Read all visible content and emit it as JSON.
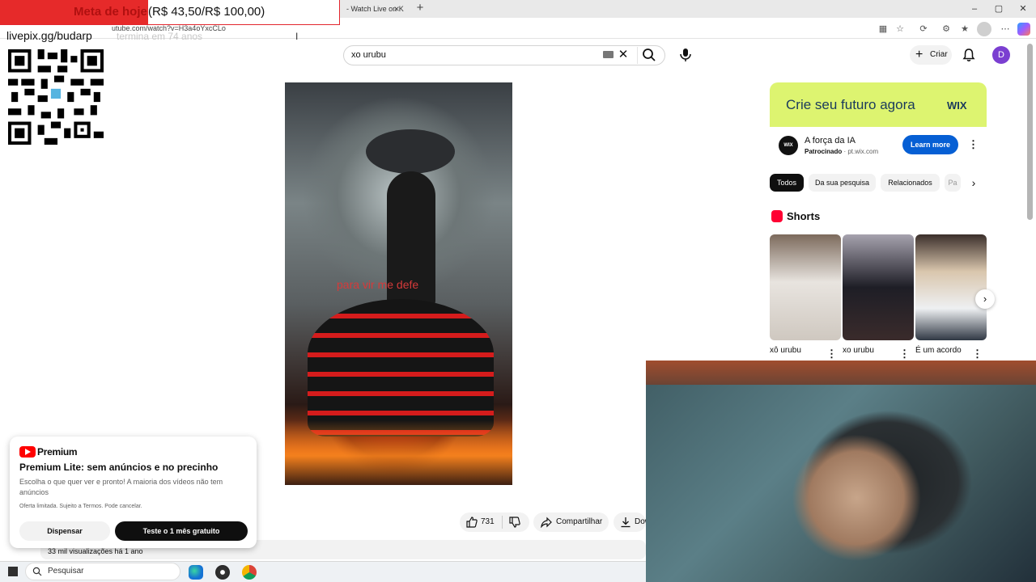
{
  "browser": {
    "tab_fragment": "- Watch Live on K",
    "tab_close": "×",
    "new_tab": "+",
    "url": "utube.com/watch?v=H3a4oYxcCLo",
    "window_controls": [
      "–",
      "▢",
      "✕"
    ]
  },
  "overlay": {
    "goal_label": "Meta de hoje",
    "goal_amount": "(R$ 43,50/R$ 100,00)",
    "goal_progress": 0.435,
    "livepix_user": "livepix.gg/budarp",
    "ghost_text": "termina em 74 anos"
  },
  "youtube": {
    "search_value": "xo urubu",
    "create_label": "Criar",
    "avatar_letter": "D"
  },
  "video": {
    "caption": "para vir me defe"
  },
  "actions": {
    "like_count": "731",
    "share_label": "Compartilhar",
    "download_label": "Download"
  },
  "description": {
    "views": "33 mil visualizações  há 1 ano"
  },
  "premium": {
    "brand": "Premium",
    "title": "Premium Lite: sem anúncios e no precinho",
    "description": "Escolha o que quer ver e pronto! A maioria dos vídeos não tem anúncios",
    "fine_print": "Oferta limitada. Sujeito a Termos. Pode cancelar.",
    "dismiss_label": "Dispensar",
    "trial_label": "Teste o 1 mês gratuito"
  },
  "ad": {
    "headline": "Crie seu futuro agora",
    "brand": "WIX",
    "logo_text": "WIX",
    "title": "A força da IA",
    "sponsor_label": "Patrocinado",
    "sponsor_domain": "· pt.wix.com",
    "cta": "Learn more",
    "accent_color": "#ddf470"
  },
  "chips": [
    "Todos",
    "Da sua pesquisa",
    "Relacionados",
    "Pa"
  ],
  "shorts": {
    "title": "Shorts",
    "items": [
      {
        "title": "xô urubu"
      },
      {
        "title": "xo urubu"
      },
      {
        "title": "É um acordo"
      }
    ]
  },
  "taskbar": {
    "search_label": "Pesquisar"
  }
}
